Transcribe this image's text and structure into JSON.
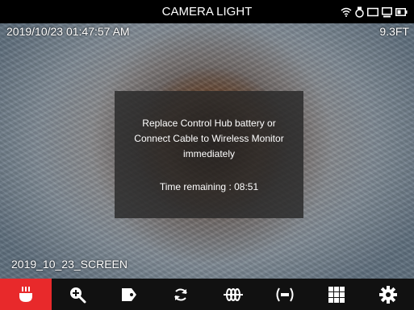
{
  "statusbar": {
    "title": "CAMERA LIGHT",
    "icons": [
      "wifi-icon",
      "camera-icon",
      "monitor-icon",
      "display-icon",
      "battery-icon"
    ]
  },
  "overlay": {
    "timestamp": "2019/10/23 01:47:57 AM",
    "depth": "9.3FT",
    "filename": "2019_10_23_SCREEN"
  },
  "dialog": {
    "line1": "Replace Control Hub battery or",
    "line2": "Connect Cable to Wireless Monitor",
    "line3": "immediately",
    "time_remaining": "Time remaining : 08:51"
  },
  "toolbar": {
    "active_tool": "camera-light",
    "tools": [
      "camera-light-icon",
      "zoom-icon",
      "tag-icon",
      "rotate-icon",
      "sonde-icon",
      "transmitter-icon",
      "grid-icon",
      "settings-icon"
    ]
  },
  "colors": {
    "active": "#e8292b",
    "toolbar_bg": "#111111"
  }
}
